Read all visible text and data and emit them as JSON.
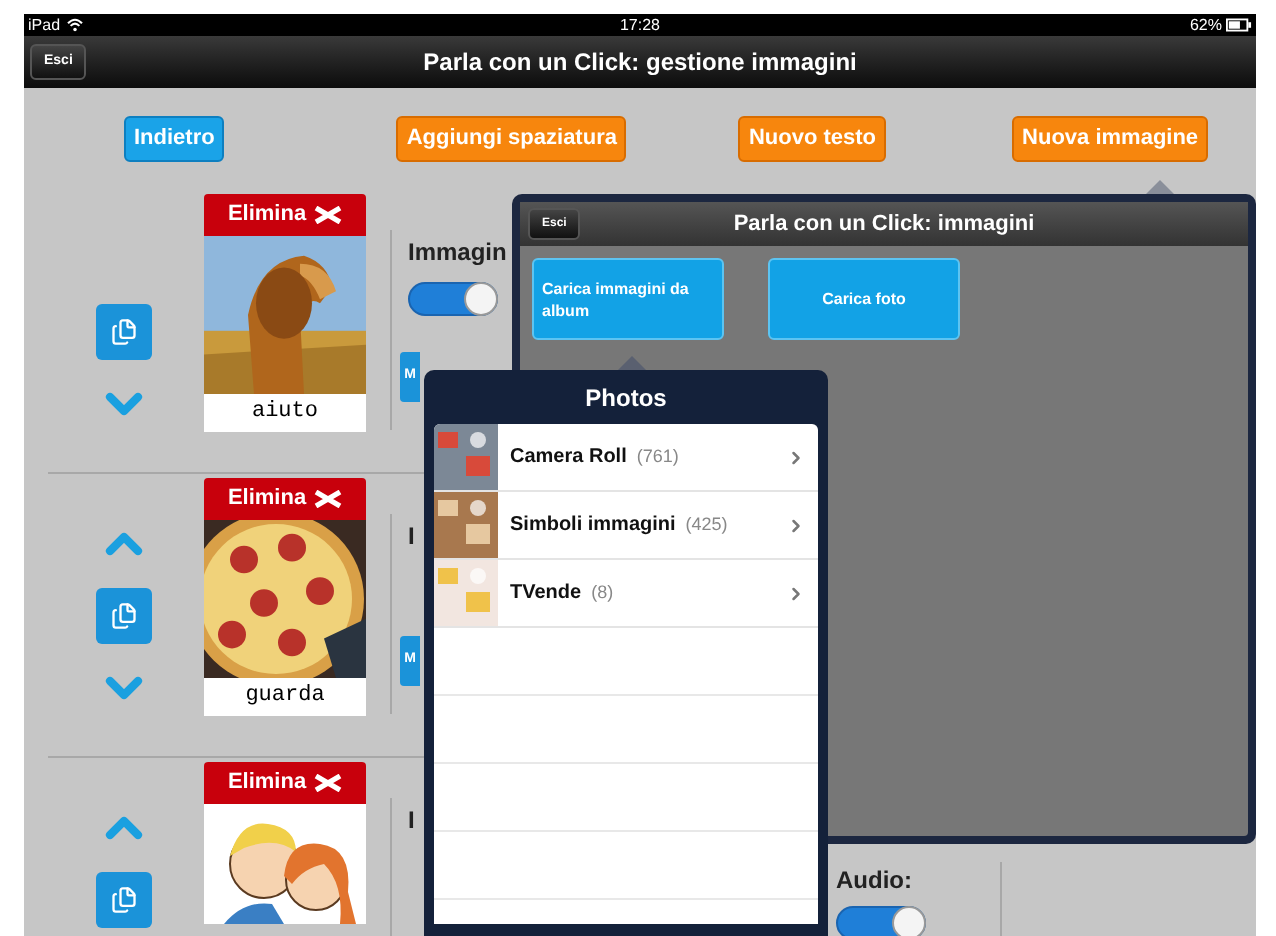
{
  "status_bar": {
    "device": "iPad",
    "time": "17:28",
    "battery": "62%"
  },
  "nav_bar": {
    "back_button": "Esci",
    "title": "Parla con un Click: gestione immagini"
  },
  "toolbar": [
    {
      "label": "Indietro",
      "kind": "blue"
    },
    {
      "label": "Aggiungi spaziatura",
      "kind": "orange"
    },
    {
      "label": "Nuovo testo",
      "kind": "orange"
    },
    {
      "label": "Nuova immagine",
      "kind": "orange"
    }
  ],
  "rows": [
    {
      "delete_label": "Elimina",
      "caption": "aiuto",
      "move_up": false,
      "move_down": true,
      "label": "Immagin",
      "switch_on": true,
      "side_button": "M"
    },
    {
      "delete_label": "Elimina",
      "caption": "guarda",
      "move_up": true,
      "move_down": true,
      "label": "I",
      "side_button": "M"
    },
    {
      "delete_label": "Elimina",
      "move_up": true,
      "move_down": false,
      "label": "I",
      "audio": {
        "label": "Audio:",
        "on": true
      }
    }
  ],
  "images_popover": {
    "back_button": "Esci",
    "title": "Parla con un Click: immagini",
    "buttons": [
      "Carica immagini da album",
      "Carica foto"
    ]
  },
  "photos_popover": {
    "title": "Photos",
    "albums": [
      {
        "name": "Camera Roll",
        "count": "(761)"
      },
      {
        "name": "Simboli immagini",
        "count": "(425)"
      },
      {
        "name": "TVende",
        "count": "(8)"
      }
    ]
  }
}
